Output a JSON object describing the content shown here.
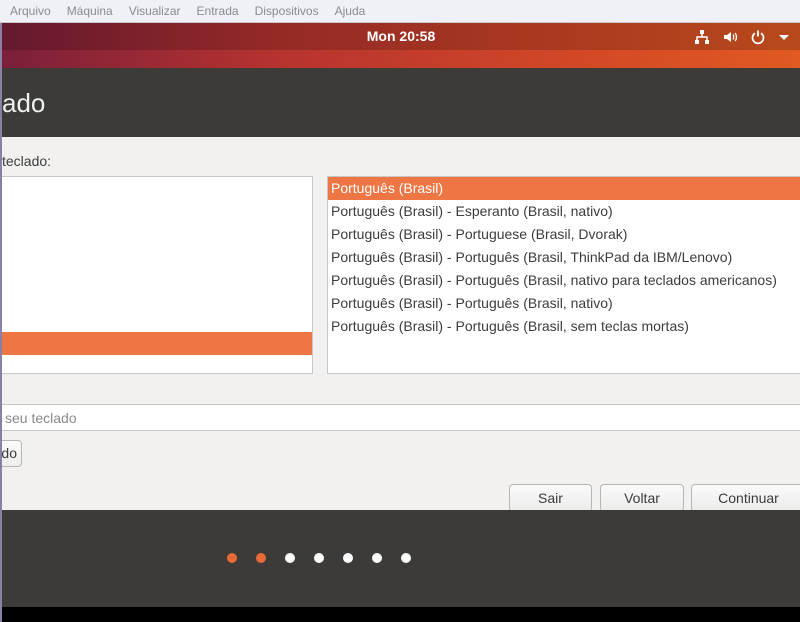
{
  "vbox_menu": [
    "Arquivo",
    "Máquina",
    "Visualizar",
    "Entrada",
    "Dispositivos",
    "Ajuda"
  ],
  "top_panel": {
    "clock": "Mon 20:58",
    "icons": [
      "network-icon",
      "volume-icon",
      "power-icon",
      "dropdown-arrow-icon"
    ]
  },
  "installer": {
    "header_title": "ado",
    "prompt": "teclado:",
    "variants": [
      "Português (Brasil)",
      "Português (Brasil) - Esperanto (Brasil, nativo)",
      "Português (Brasil) - Portuguese (Brasil, Dvorak)",
      "Português (Brasil) - Português (Brasil, ThinkPad da IBM/Lenovo)",
      "Português (Brasil) - Português (Brasil, nativo para teclados americanos)",
      "Português (Brasil) - Português (Brasil, nativo)",
      "Português (Brasil) - Português (Brasil, sem teclas mortas)"
    ],
    "selected_variant_index": 0,
    "test_placeholder": "seu teclado",
    "detect_label": "do",
    "buttons": {
      "quit": "Sair",
      "back": "Voltar",
      "continue": "Continuar"
    }
  },
  "progress": {
    "total_dots": 7,
    "completed_dots": 2
  },
  "colors": {
    "accent": "#ee7645",
    "panel_dark": "#3c3b37",
    "content_bg": "#f2f1f0"
  }
}
